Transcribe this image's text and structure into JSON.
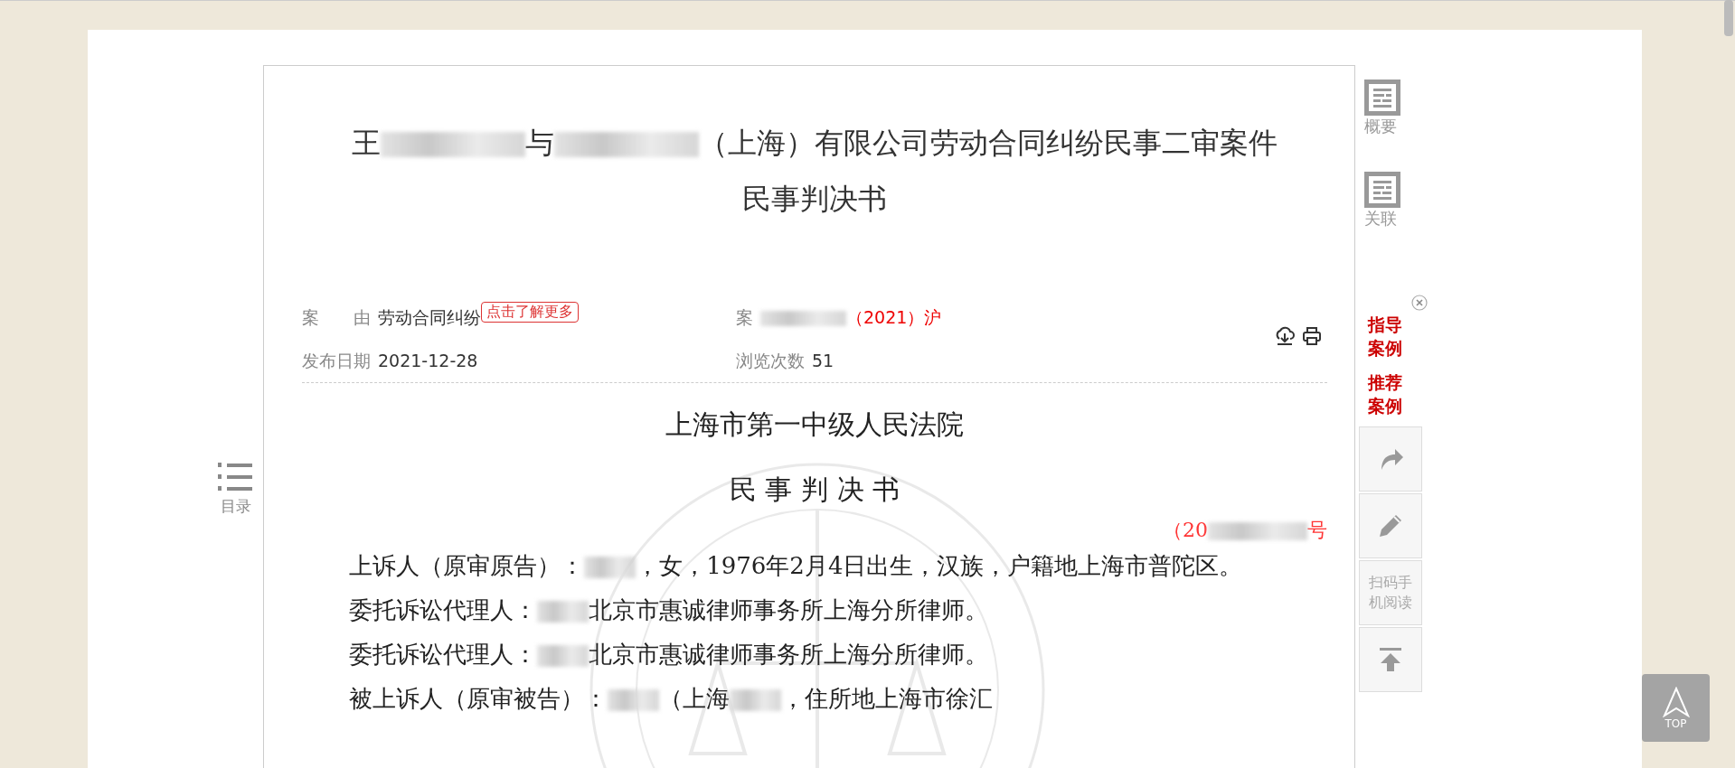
{
  "title": {
    "line_1": [
      {
        "kind": "text",
        "text": "王"
      },
      {
        "kind": "redacted"
      },
      {
        "kind": "text",
        "text": "与"
      },
      {
        "kind": "redacted"
      },
      {
        "kind": "text",
        "text": "（上海）有限公司劳动合同纠纷民事二审案件"
      }
    ],
    "line_2": "民事判决书"
  },
  "meta": {
    "cause_label": "案　　由",
    "cause_value": "劳动合同纠纷",
    "more_badge": "点击了解更多",
    "case_no": [
      {
        "kind": "label",
        "text": "案"
      },
      {
        "kind": "redacted"
      },
      {
        "kind": "red",
        "text": "（2021）沪"
      }
    ],
    "date_label": "发布日期",
    "date_value": "2021-12-28",
    "views_label": "浏览次数",
    "views_value": "51"
  },
  "toc": {
    "label": "目录"
  },
  "document": {
    "court": "上海市第一中级人民法院",
    "doc_type": "民 事 判 决 书",
    "case_number": [
      {
        "kind": "red",
        "text": "（20"
      },
      {
        "kind": "redacted"
      },
      {
        "kind": "red",
        "text": "号"
      }
    ],
    "paragraphs": [
      [
        {
          "kind": "text",
          "text": "上诉人（原审原告）："
        },
        {
          "kind": "redacted"
        },
        {
          "kind": "text",
          "text": "，女，1976年2月4日出生，汉族，户籍地上海市普陀区。"
        }
      ],
      [
        {
          "kind": "text",
          "text": "委托诉讼代理人："
        },
        {
          "kind": "redacted"
        },
        {
          "kind": "text",
          "text": "北京市惠诚律师事务所上海分所律师。"
        }
      ],
      [
        {
          "kind": "text",
          "text": "委托诉讼代理人："
        },
        {
          "kind": "redacted"
        },
        {
          "kind": "text",
          "text": "北京市惠诚律师事务所上海分所律师。"
        }
      ],
      [
        {
          "kind": "text",
          "text": "被上诉人（原审被告）："
        },
        {
          "kind": "redacted"
        },
        {
          "kind": "text",
          "text": "（上海"
        },
        {
          "kind": "redacted"
        },
        {
          "kind": "text",
          "text": "，住所地上海市徐汇"
        }
      ]
    ]
  },
  "sidebar": {
    "links": [
      {
        "label": "概要"
      },
      {
        "label": "关联"
      }
    ],
    "featured": [
      "指导案例",
      "推荐案例"
    ],
    "tools": [
      {
        "kind": "share"
      },
      {
        "kind": "edit"
      },
      {
        "kind": "text",
        "label": "扫码手机阅读"
      },
      {
        "kind": "top"
      }
    ]
  },
  "top_button": {
    "label": "TOP"
  }
}
